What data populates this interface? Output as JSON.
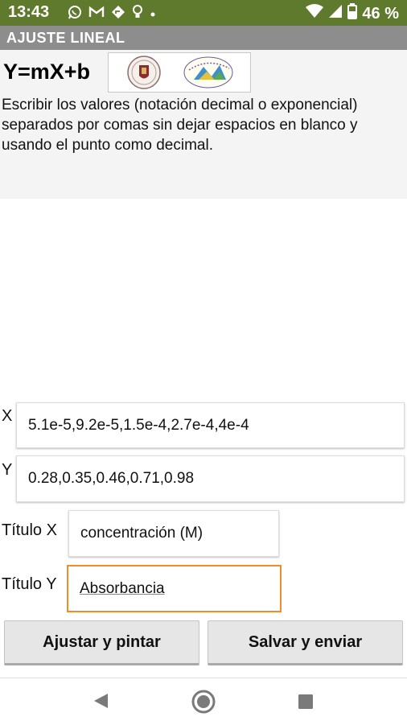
{
  "status_bar": {
    "time": "13:43",
    "battery": "46 %"
  },
  "app": {
    "title": "AJUSTE LINEAL"
  },
  "header": {
    "equation": "Y=mX+b",
    "instructions": "Escribir los valores (notación decimal o exponencial) separados por comas sin dejar espacios en blanco y usando el punto como decimal."
  },
  "form": {
    "x_label": "X",
    "x_value": "5.1e-5,9.2e-5,1.5e-4,2.7e-4,4e-4",
    "y_label": "Y",
    "y_value": "0.28,0.35,0.46,0.71,0.98",
    "title_x_label": "Título X",
    "title_x_value": "concentración (M)",
    "title_y_label": "Título Y",
    "title_y_value": "Absorbancia"
  },
  "buttons": {
    "fit_label": "Ajustar y pintar",
    "save_label": "Salvar y enviar"
  },
  "colors": {
    "status_bar": "#5f7a2d",
    "title_bar": "#8d8d8d",
    "focus": "#f28c28",
    "button": "#e6e6e6"
  },
  "icons": [
    "whatsapp-icon",
    "gmail-icon",
    "maps-icon",
    "bulb-icon",
    "dot-icon",
    "wifi-icon",
    "signal-icon",
    "battery-icon",
    "back-icon",
    "home-icon",
    "recents-icon"
  ]
}
